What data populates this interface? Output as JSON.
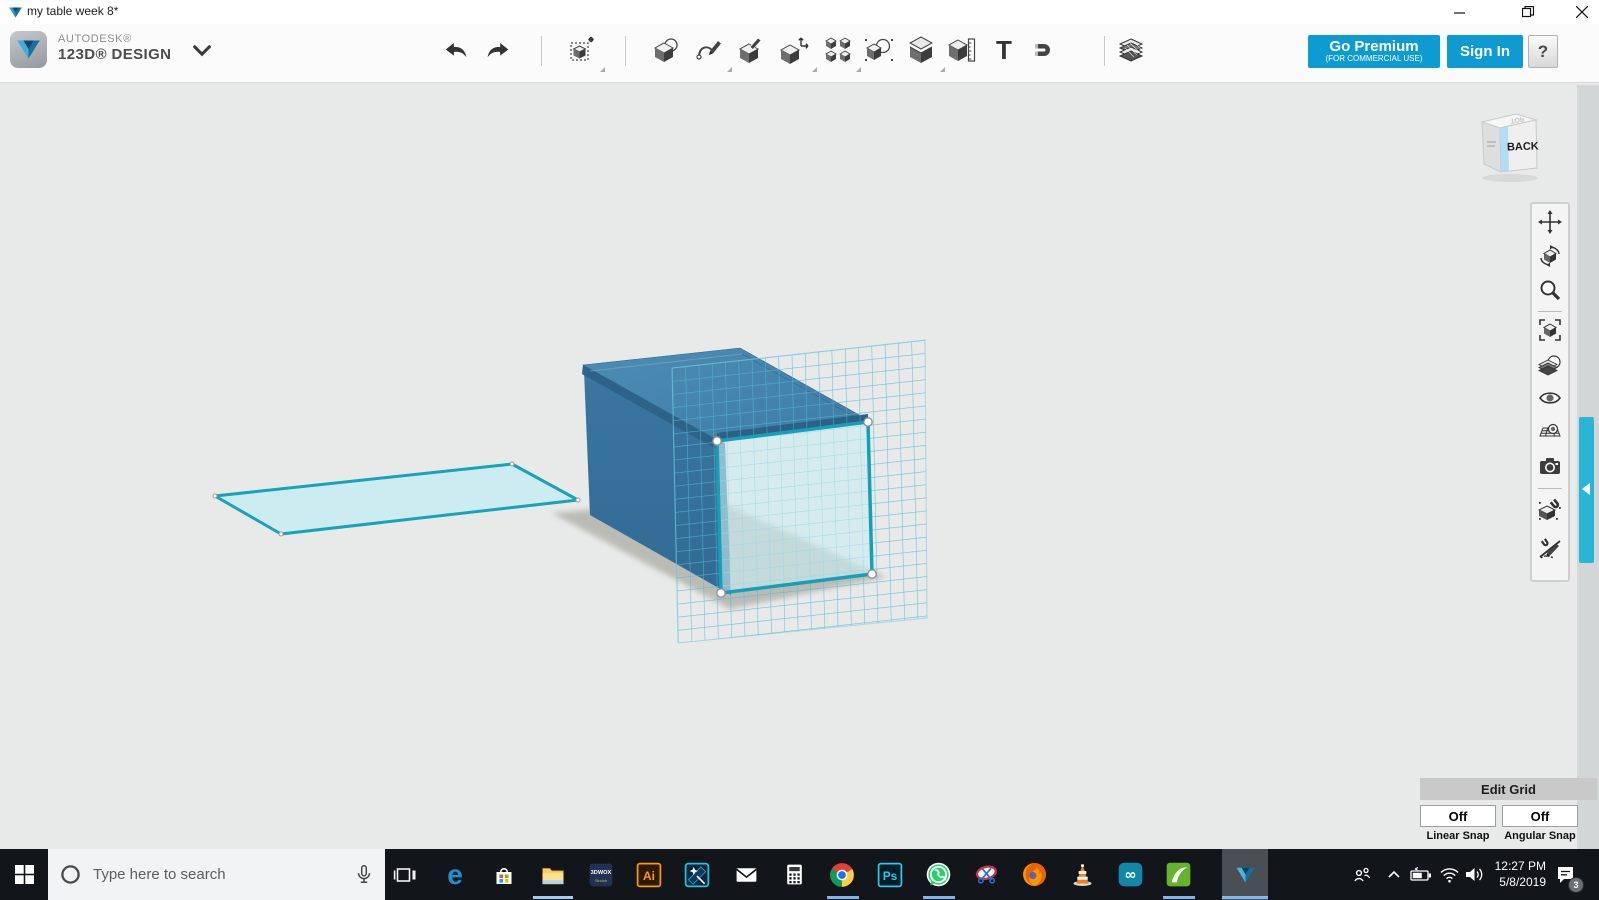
{
  "window": {
    "title": "my table week 8*",
    "controls": [
      "minimize",
      "restore",
      "close"
    ]
  },
  "header": {
    "brand_line1": "AUTODESK®",
    "brand_line2": "123D® DESIGN",
    "go_premium": "Go Premium",
    "go_premium_sub": "(FOR COMMERCIAL USE)",
    "sign_in": "Sign In",
    "help_label": "?",
    "toolbar_icons": [
      "undo",
      "redo",
      "transform-move",
      "primitives",
      "sketch",
      "modify",
      "move-measure",
      "pattern",
      "combine",
      "group",
      "measure-ruler",
      "text",
      "magnet-snap",
      "material-layers"
    ],
    "text_tool_glyph": "T"
  },
  "viewcube": {
    "front_label": "BACK"
  },
  "right_toolbar": {
    "icons": [
      "pan",
      "orbit",
      "zoom",
      "fit-view",
      "material-style",
      "show-hide",
      "show-sketches",
      "screenshot",
      "snap-toggle",
      "sketch-snap-toggle"
    ]
  },
  "grid_panel": {
    "edit_grid_label": "Edit Grid",
    "linear_value": "Off",
    "angular_value": "Off",
    "linear_label": "Linear Snap",
    "angular_label": "Angular Snap"
  },
  "scene": {
    "objects": [
      "flat-rectangle-sketch",
      "blue-box-solid",
      "sketch-grid-plane",
      "selected-square-profile"
    ],
    "selection_color": "#14a0b6",
    "box_top_color": "#4285ae",
    "box_side_color": "#35719a"
  },
  "taskbar": {
    "search_placeholder": "Type here to search",
    "apps": [
      "task-view",
      "edge",
      "store",
      "file-explorer",
      "3dwox",
      "illustrator",
      "video-editor",
      "mail",
      "calculator",
      "chrome",
      "photoshop",
      "whatsapp",
      "snipping-tool",
      "firefox",
      "vlc",
      "arduino",
      "coreldraw",
      "123d-design"
    ],
    "active_apps": [
      "file-explorer",
      "chrome",
      "whatsapp",
      "coreldraw",
      "123d-design"
    ],
    "glyphs": {
      "dwox": "3DWOX",
      "sindoh": "Sindoh",
      "ai": "Ai",
      "ps": "Ps",
      "infinity": "∞",
      "edge_e": "e"
    },
    "tray": {
      "time": "12:27 PM",
      "date": "5/8/2019",
      "badge": "3"
    }
  },
  "colors": {
    "accent_blue": "#0e9bd2",
    "teal": "#14a0b6",
    "canvas_bg": "#e8e9e9",
    "taskbar_bg": "#12161b",
    "tab_cyan": "#29b5d8"
  }
}
